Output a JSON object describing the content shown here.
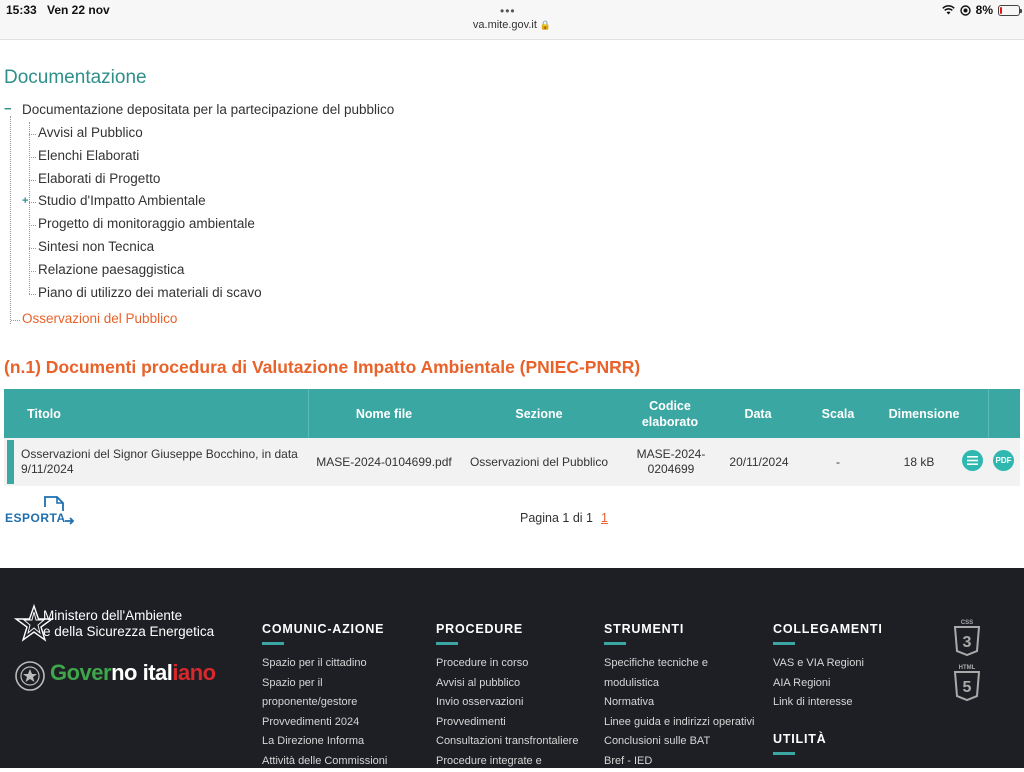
{
  "status_bar": {
    "time": "15:33",
    "date": "Ven 22 nov",
    "url": "va.mite.gov.it",
    "battery": "8%",
    "battery_level": 0.08
  },
  "doc": {
    "title": "Documentazione",
    "tree_root": "Documentazione depositata per la partecipazione del pubblico",
    "tree_items": [
      "Avvisi al Pubblico",
      "Elenchi Elaborati",
      "Elaborati di Progetto",
      "Studio d'Impatto Ambientale",
      "Progetto di monitoraggio ambientale",
      "Sintesi non Tecnica",
      "Relazione paesaggistica",
      "Piano di utilizzo dei materiali di scavo"
    ],
    "observations": "Osservazioni del Pubblico"
  },
  "section": {
    "title": "(n.1) Documenti procedura di Valutazione Impatto Ambientale (PNIEC-PNRR)"
  },
  "table": {
    "headers": [
      "Titolo",
      "Nome file",
      "Sezione",
      "Codice elaborato",
      "Data",
      "Scala",
      "Dimensione"
    ],
    "rows": [
      {
        "titolo": "Osservazioni del Signor Giuseppe Bocchino, in data 9/11/2024",
        "nome_file": "MASE-2024-0104699.pdf",
        "sezione": "Osservazioni del Pubblico",
        "codice": "MASE-2024-0204699",
        "data": "20/11/2024",
        "scala": "-",
        "dimensione": "18 kB",
        "pdf_label": "PDF"
      }
    ]
  },
  "export": {
    "label": "ESPORTA"
  },
  "pager": {
    "text": "Pagina 1 di 1",
    "page": "1"
  },
  "footer": {
    "ministry_line1": "Ministero dell'Ambiente",
    "ministry_line2": "e della Sicurezza Energetica",
    "gov_part1": "Gover",
    "gov_part2": "no ital",
    "gov_part3": "iano",
    "columns": [
      {
        "heading": "COMUNIC-AZIONE",
        "links": [
          "Spazio per il cittadino",
          "Spazio per il",
          "proponente/gestore",
          "Provvedimenti 2024",
          "La Direzione Informa",
          "Attività delle Commissioni"
        ]
      },
      {
        "heading": "PROCEDURE",
        "links": [
          "Procedure in corso",
          "Avvisi al pubblico",
          "Invio osservazioni",
          "Provvedimenti",
          "Consultazioni transfrontaliere",
          "Procedure integrate e"
        ]
      },
      {
        "heading": "STRUMENTI",
        "links": [
          "Specifiche tecniche e",
          "modulistica",
          "Normativa",
          "Linee guida e indirizzi operativi",
          "Conclusioni sulle BAT",
          "Bref - IED"
        ]
      },
      {
        "heading": "COLLEGAMENTI",
        "links": [
          "VAS e VIA Regioni",
          "AIA Regioni",
          "Link di interesse"
        ]
      }
    ],
    "utility_heading": "UTILITÀ",
    "css_badge": "CSS",
    "html_badge": "HTML",
    "badge_digit": "3",
    "badge_digit2": "5"
  },
  "colors": {
    "teal": "#3ba7a2",
    "orange": "#e8622a",
    "footer_bg": "#1d1f25"
  }
}
